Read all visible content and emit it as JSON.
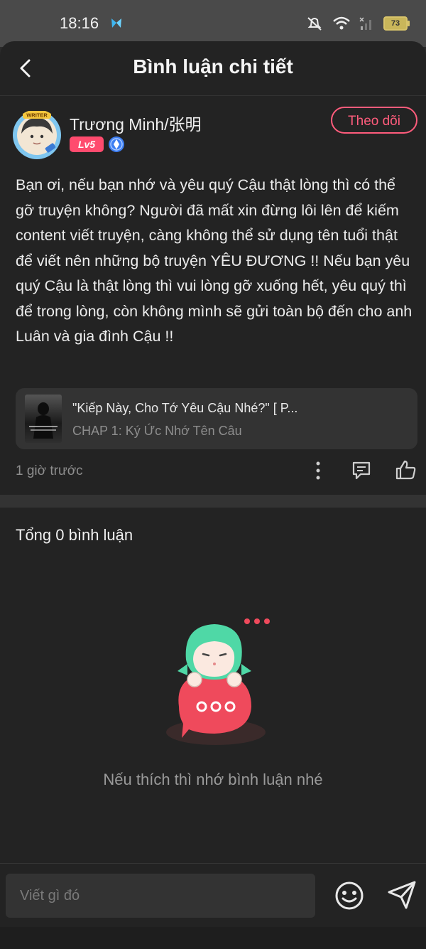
{
  "status_bar": {
    "time": "18:16",
    "battery": "73"
  },
  "header": {
    "title": "Bình luận chi tiết"
  },
  "author": {
    "name": "Trương Minh/张明",
    "level": "Lv5",
    "avatar_badge": "WRITER",
    "follow_label": "Theo dõi"
  },
  "comment": {
    "text": "Bạn ơi, nếu bạn nhớ và yêu quý Cậu thật lòng thì có thể gỡ truyện không? Người đã mất xin đừng lôi lên để kiếm content viết truyện, càng không thể sử dụng tên tuổi thật để viết nên những bộ truyện YÊU ĐƯƠNG !! Nếu bạn yêu quý Cậu là thật lòng thì vui lòng gỡ xuống hết, yêu quý thì để trong lòng, còn không mình sẽ gửi toàn bộ đến cho anh Luân và gia đình Cậu !!",
    "time_ago": "1 giờ trước"
  },
  "story": {
    "title": "\"Kiếp Này, Cho Tớ Yêu Cậu Nhé?\" [ P...",
    "chapter": "CHAP 1: Ký Ức Nhớ Tên Câu"
  },
  "comments_section": {
    "total_label": "Tổng 0 bình luận",
    "empty_message": "Nếu thích thì nhớ bình luận nhé"
  },
  "composer": {
    "placeholder": "Viết gì đó"
  },
  "colors": {
    "accent": "#ff5c7c",
    "background": "#232323",
    "panel": "#333333",
    "mascot_hair": "#4fd8a6",
    "bubble": "#ef4a5c"
  }
}
